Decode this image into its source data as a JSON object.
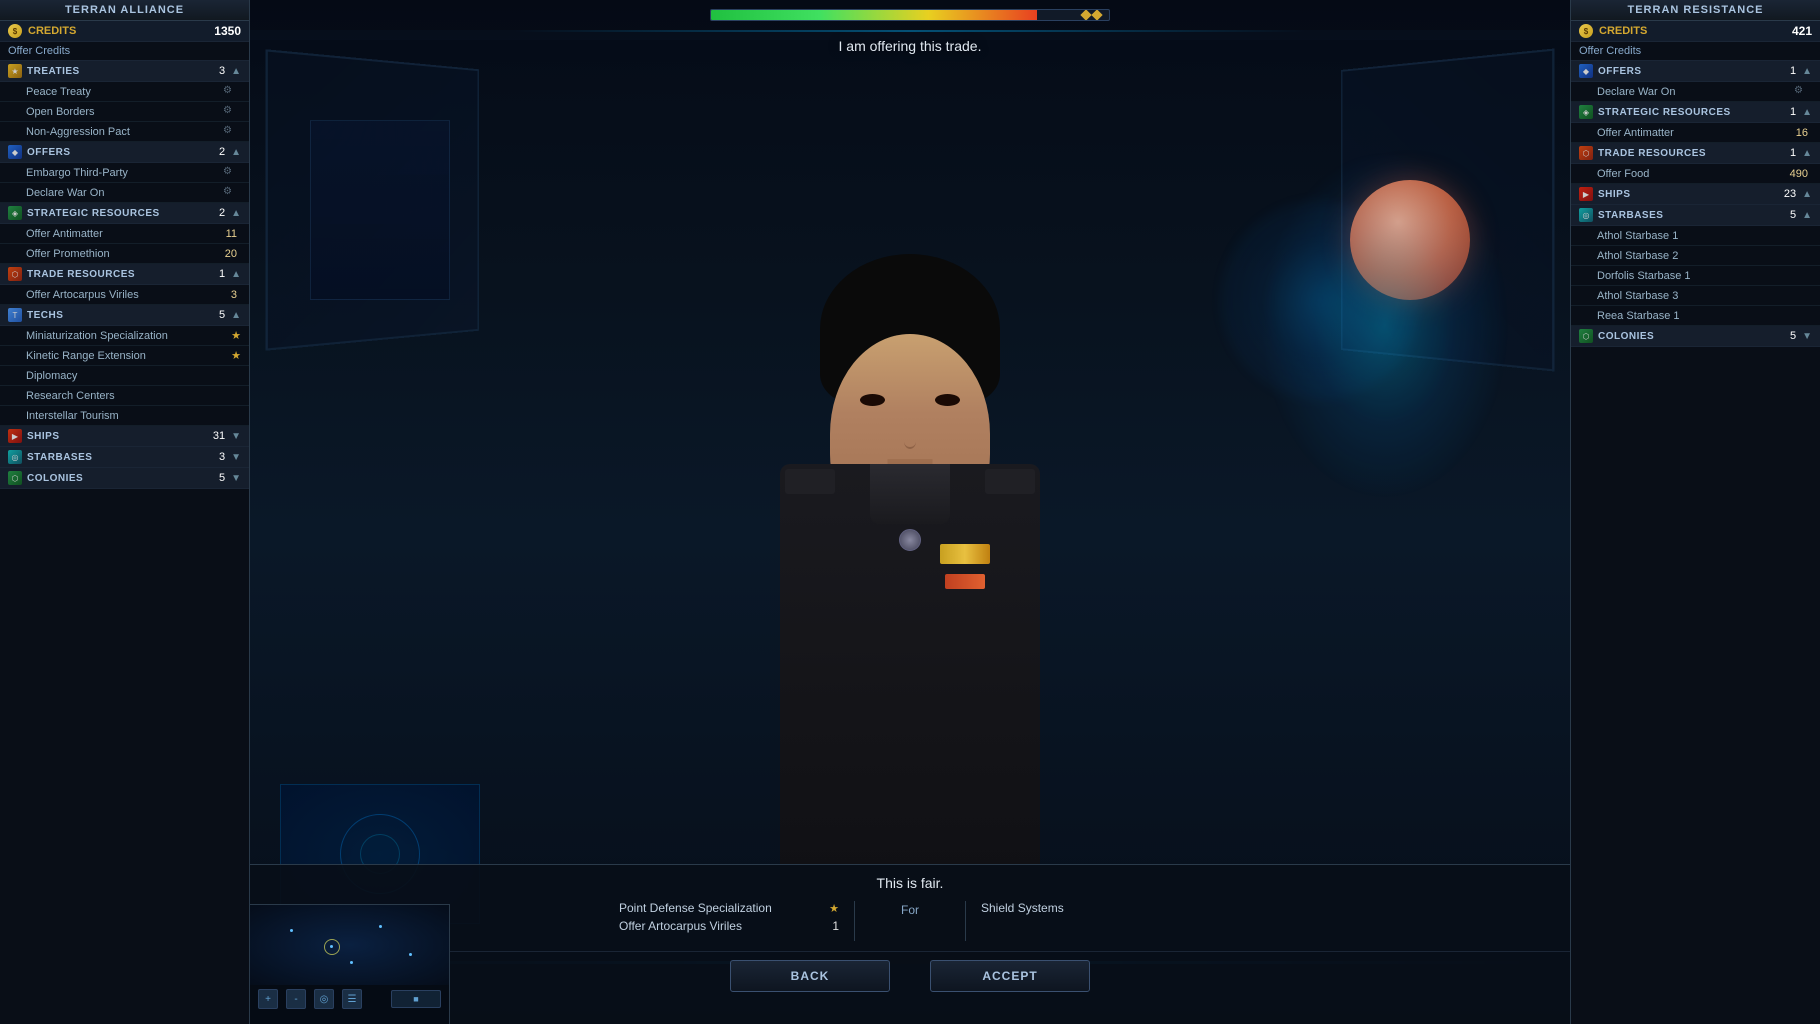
{
  "left_panel": {
    "title": "Terran Alliance",
    "credits_label": "Credits",
    "credits_value": "1350",
    "offer_credits_btn": "Offer Credits",
    "sections": [
      {
        "id": "treaties",
        "icon_class": "gold",
        "icon_symbol": "★",
        "title": "TreaTIES",
        "count": "3",
        "collapsed": false,
        "items": [
          {
            "name": "Peace Treaty",
            "value": "",
            "has_icon": true
          },
          {
            "name": "Open Borders",
            "value": "",
            "has_icon": true
          },
          {
            "name": "Non-Aggression Pact",
            "value": "",
            "has_icon": true
          }
        ]
      },
      {
        "id": "offers",
        "icon_class": "blue",
        "icon_symbol": "◆",
        "title": "Offers",
        "count": "2",
        "collapsed": false,
        "items": [
          {
            "name": "Embargo Third-Party",
            "value": "",
            "has_icon": true
          },
          {
            "name": "Declare War On",
            "value": "",
            "has_icon": true
          }
        ]
      },
      {
        "id": "strategic_resources",
        "icon_class": "green",
        "icon_symbol": "◈",
        "title": "strateGiC ResourCES",
        "count": "2",
        "collapsed": false,
        "items": [
          {
            "name": "Offer Antimatter",
            "value": "11",
            "has_icon": false
          },
          {
            "name": "Offer Promethion",
            "value": "20",
            "has_icon": false
          }
        ]
      },
      {
        "id": "trade_resources",
        "icon_class": "orange",
        "icon_symbol": "⬡",
        "title": "Trade Resources",
        "count": "1",
        "collapsed": false,
        "items": [
          {
            "name": "Offer Artocarpus Viriles",
            "value": "3",
            "has_icon": false
          }
        ]
      },
      {
        "id": "techs",
        "icon_class": "blue",
        "icon_symbol": "⬡",
        "title": "Techs",
        "count": "5",
        "collapsed": false,
        "items": [
          {
            "name": "Miniaturization Specialization",
            "value": "★",
            "has_icon": false
          },
          {
            "name": "Kinetic Range Extension",
            "value": "★",
            "has_icon": false
          },
          {
            "name": "Diplomacy",
            "value": "",
            "has_icon": false
          },
          {
            "name": "Research Centers",
            "value": "",
            "has_icon": false
          },
          {
            "name": "Interstellar Tourism",
            "value": "",
            "has_icon": false
          }
        ]
      },
      {
        "id": "ships",
        "icon_class": "red",
        "icon_symbol": "▶",
        "title": "Ships",
        "count": "31",
        "collapsed": true,
        "items": []
      },
      {
        "id": "starbases",
        "icon_class": "teal",
        "icon_symbol": "◎",
        "title": "Starbases",
        "count": "3",
        "collapsed": true,
        "items": []
      },
      {
        "id": "colonies",
        "icon_class": "green",
        "icon_symbol": "⬡",
        "title": "Colonies",
        "count": "5",
        "collapsed": true,
        "items": []
      }
    ]
  },
  "right_panel": {
    "title": "Terran Resistance",
    "credits_label": "Credits",
    "credits_value": "421",
    "offer_credits_btn": "Offer Credits",
    "sections": [
      {
        "id": "offers_r",
        "icon_class": "blue",
        "icon_symbol": "◆",
        "title": "Offers",
        "count": "1",
        "collapsed": false,
        "items": [
          {
            "name": "Declare War On",
            "value": "",
            "has_icon": true
          }
        ]
      },
      {
        "id": "strategic_r",
        "icon_class": "green",
        "icon_symbol": "◈",
        "title": "Strategic Resources",
        "count": "1",
        "collapsed": false,
        "items": [
          {
            "name": "Offer Antimatter",
            "value": "16",
            "has_icon": false
          }
        ]
      },
      {
        "id": "trade_r",
        "icon_class": "orange",
        "icon_symbol": "⬡",
        "title": "Trade Resources",
        "count": "1",
        "collapsed": false,
        "items": [
          {
            "name": "Offer Food",
            "value": "490",
            "has_icon": false
          }
        ]
      },
      {
        "id": "ships_r",
        "icon_class": "red",
        "icon_symbol": "▶",
        "title": "Ships",
        "count": "23",
        "collapsed": false,
        "items": []
      },
      {
        "id": "starbases_r",
        "icon_class": "teal",
        "icon_symbol": "◎",
        "title": "Starbases",
        "count": "5",
        "collapsed": false,
        "items": [
          {
            "name": "Athol Starbase 1",
            "value": "",
            "has_icon": false
          },
          {
            "name": "Athol Starbase 2",
            "value": "",
            "has_icon": false
          },
          {
            "name": "Dorfolis Starbase 1",
            "value": "",
            "has_icon": false
          },
          {
            "name": "Athol Starbase 3",
            "value": "",
            "has_icon": false
          },
          {
            "name": "Reea Starbase 1",
            "value": "",
            "has_icon": false
          }
        ]
      },
      {
        "id": "colonies_r",
        "icon_class": "green",
        "icon_symbol": "⬡",
        "title": "Colonies",
        "count": "5",
        "collapsed": true,
        "items": []
      }
    ]
  },
  "top_bar": {
    "progress": 82
  },
  "speech": {
    "text": "I am offering this trade."
  },
  "trade_dialog": {
    "title": "This is fair.",
    "offer_items": [
      {
        "name": "Point Defense Specialization",
        "value": "★"
      },
      {
        "name": "Offer Artocarpus Viriles",
        "value": "1"
      }
    ],
    "for_label": "For",
    "receive_items": [
      {
        "name": "Shield Systems",
        "value": ""
      }
    ]
  },
  "buttons": {
    "back": "Back",
    "accept": "Accept"
  }
}
